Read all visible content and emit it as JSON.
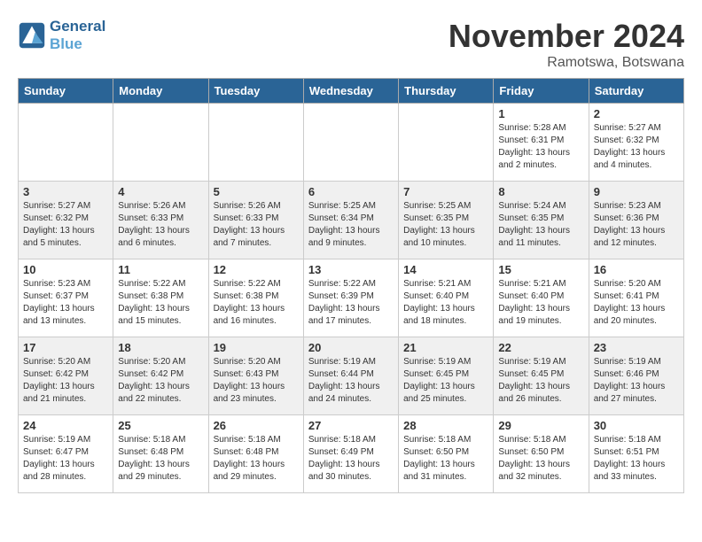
{
  "header": {
    "logo_line1": "General",
    "logo_line2": "Blue",
    "month": "November 2024",
    "location": "Ramotswa, Botswana"
  },
  "weekdays": [
    "Sunday",
    "Monday",
    "Tuesday",
    "Wednesday",
    "Thursday",
    "Friday",
    "Saturday"
  ],
  "weeks": [
    [
      {
        "day": "",
        "info": ""
      },
      {
        "day": "",
        "info": ""
      },
      {
        "day": "",
        "info": ""
      },
      {
        "day": "",
        "info": ""
      },
      {
        "day": "",
        "info": ""
      },
      {
        "day": "1",
        "info": "Sunrise: 5:28 AM\nSunset: 6:31 PM\nDaylight: 13 hours\nand 2 minutes."
      },
      {
        "day": "2",
        "info": "Sunrise: 5:27 AM\nSunset: 6:32 PM\nDaylight: 13 hours\nand 4 minutes."
      }
    ],
    [
      {
        "day": "3",
        "info": "Sunrise: 5:27 AM\nSunset: 6:32 PM\nDaylight: 13 hours\nand 5 minutes."
      },
      {
        "day": "4",
        "info": "Sunrise: 5:26 AM\nSunset: 6:33 PM\nDaylight: 13 hours\nand 6 minutes."
      },
      {
        "day": "5",
        "info": "Sunrise: 5:26 AM\nSunset: 6:33 PM\nDaylight: 13 hours\nand 7 minutes."
      },
      {
        "day": "6",
        "info": "Sunrise: 5:25 AM\nSunset: 6:34 PM\nDaylight: 13 hours\nand 9 minutes."
      },
      {
        "day": "7",
        "info": "Sunrise: 5:25 AM\nSunset: 6:35 PM\nDaylight: 13 hours\nand 10 minutes."
      },
      {
        "day": "8",
        "info": "Sunrise: 5:24 AM\nSunset: 6:35 PM\nDaylight: 13 hours\nand 11 minutes."
      },
      {
        "day": "9",
        "info": "Sunrise: 5:23 AM\nSunset: 6:36 PM\nDaylight: 13 hours\nand 12 minutes."
      }
    ],
    [
      {
        "day": "10",
        "info": "Sunrise: 5:23 AM\nSunset: 6:37 PM\nDaylight: 13 hours\nand 13 minutes."
      },
      {
        "day": "11",
        "info": "Sunrise: 5:22 AM\nSunset: 6:38 PM\nDaylight: 13 hours\nand 15 minutes."
      },
      {
        "day": "12",
        "info": "Sunrise: 5:22 AM\nSunset: 6:38 PM\nDaylight: 13 hours\nand 16 minutes."
      },
      {
        "day": "13",
        "info": "Sunrise: 5:22 AM\nSunset: 6:39 PM\nDaylight: 13 hours\nand 17 minutes."
      },
      {
        "day": "14",
        "info": "Sunrise: 5:21 AM\nSunset: 6:40 PM\nDaylight: 13 hours\nand 18 minutes."
      },
      {
        "day": "15",
        "info": "Sunrise: 5:21 AM\nSunset: 6:40 PM\nDaylight: 13 hours\nand 19 minutes."
      },
      {
        "day": "16",
        "info": "Sunrise: 5:20 AM\nSunset: 6:41 PM\nDaylight: 13 hours\nand 20 minutes."
      }
    ],
    [
      {
        "day": "17",
        "info": "Sunrise: 5:20 AM\nSunset: 6:42 PM\nDaylight: 13 hours\nand 21 minutes."
      },
      {
        "day": "18",
        "info": "Sunrise: 5:20 AM\nSunset: 6:42 PM\nDaylight: 13 hours\nand 22 minutes."
      },
      {
        "day": "19",
        "info": "Sunrise: 5:20 AM\nSunset: 6:43 PM\nDaylight: 13 hours\nand 23 minutes."
      },
      {
        "day": "20",
        "info": "Sunrise: 5:19 AM\nSunset: 6:44 PM\nDaylight: 13 hours\nand 24 minutes."
      },
      {
        "day": "21",
        "info": "Sunrise: 5:19 AM\nSunset: 6:45 PM\nDaylight: 13 hours\nand 25 minutes."
      },
      {
        "day": "22",
        "info": "Sunrise: 5:19 AM\nSunset: 6:45 PM\nDaylight: 13 hours\nand 26 minutes."
      },
      {
        "day": "23",
        "info": "Sunrise: 5:19 AM\nSunset: 6:46 PM\nDaylight: 13 hours\nand 27 minutes."
      }
    ],
    [
      {
        "day": "24",
        "info": "Sunrise: 5:19 AM\nSunset: 6:47 PM\nDaylight: 13 hours\nand 28 minutes."
      },
      {
        "day": "25",
        "info": "Sunrise: 5:18 AM\nSunset: 6:48 PM\nDaylight: 13 hours\nand 29 minutes."
      },
      {
        "day": "26",
        "info": "Sunrise: 5:18 AM\nSunset: 6:48 PM\nDaylight: 13 hours\nand 29 minutes."
      },
      {
        "day": "27",
        "info": "Sunrise: 5:18 AM\nSunset: 6:49 PM\nDaylight: 13 hours\nand 30 minutes."
      },
      {
        "day": "28",
        "info": "Sunrise: 5:18 AM\nSunset: 6:50 PM\nDaylight: 13 hours\nand 31 minutes."
      },
      {
        "day": "29",
        "info": "Sunrise: 5:18 AM\nSunset: 6:50 PM\nDaylight: 13 hours\nand 32 minutes."
      },
      {
        "day": "30",
        "info": "Sunrise: 5:18 AM\nSunset: 6:51 PM\nDaylight: 13 hours\nand 33 minutes."
      }
    ]
  ]
}
